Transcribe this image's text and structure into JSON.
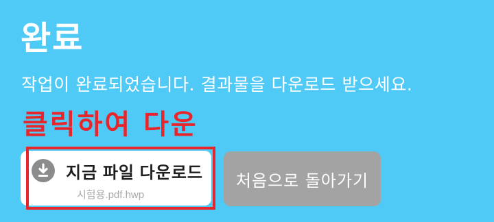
{
  "page": {
    "title": "완료",
    "subtitle": "작업이 완료되었습니다. 결과물을 다운로드 받으세요.",
    "annotation": "클릭하여 다운"
  },
  "download_button": {
    "label": "지금 파일 다운로드",
    "filename": "시험용.pdf.hwp",
    "icon": "download-icon"
  },
  "back_button": {
    "label": "처음으로 돌아가기"
  },
  "colors": {
    "background": "#4fcaf7",
    "annotation_red": "#e8252b",
    "download_button_bg": "#ffffff",
    "back_button_bg": "#a3a3a3",
    "icon_gray": "#8c8c8c"
  }
}
